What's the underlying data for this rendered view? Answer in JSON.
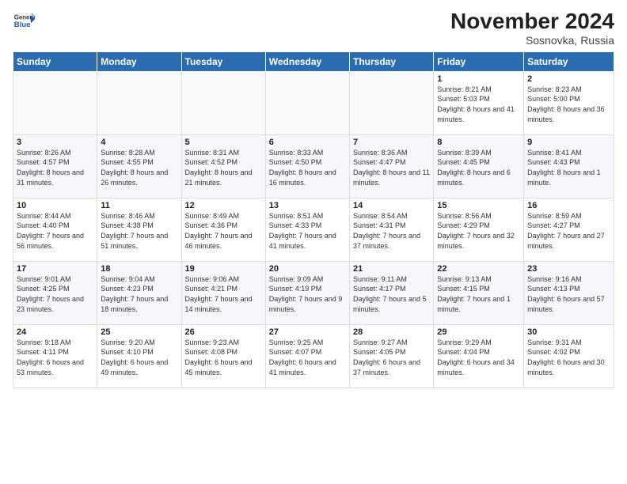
{
  "header": {
    "logo_line1": "General",
    "logo_line2": "Blue",
    "month_title": "November 2024",
    "location": "Sosnovka, Russia"
  },
  "weekdays": [
    "Sunday",
    "Monday",
    "Tuesday",
    "Wednesday",
    "Thursday",
    "Friday",
    "Saturday"
  ],
  "weeks": [
    [
      {
        "day": "",
        "info": ""
      },
      {
        "day": "",
        "info": ""
      },
      {
        "day": "",
        "info": ""
      },
      {
        "day": "",
        "info": ""
      },
      {
        "day": "",
        "info": ""
      },
      {
        "day": "1",
        "info": "Sunrise: 8:21 AM\nSunset: 5:03 PM\nDaylight: 8 hours and 41 minutes."
      },
      {
        "day": "2",
        "info": "Sunrise: 8:23 AM\nSunset: 5:00 PM\nDaylight: 8 hours and 36 minutes."
      }
    ],
    [
      {
        "day": "3",
        "info": "Sunrise: 8:26 AM\nSunset: 4:57 PM\nDaylight: 8 hours and 31 minutes."
      },
      {
        "day": "4",
        "info": "Sunrise: 8:28 AM\nSunset: 4:55 PM\nDaylight: 8 hours and 26 minutes."
      },
      {
        "day": "5",
        "info": "Sunrise: 8:31 AM\nSunset: 4:52 PM\nDaylight: 8 hours and 21 minutes."
      },
      {
        "day": "6",
        "info": "Sunrise: 8:33 AM\nSunset: 4:50 PM\nDaylight: 8 hours and 16 minutes."
      },
      {
        "day": "7",
        "info": "Sunrise: 8:36 AM\nSunset: 4:47 PM\nDaylight: 8 hours and 11 minutes."
      },
      {
        "day": "8",
        "info": "Sunrise: 8:39 AM\nSunset: 4:45 PM\nDaylight: 8 hours and 6 minutes."
      },
      {
        "day": "9",
        "info": "Sunrise: 8:41 AM\nSunset: 4:43 PM\nDaylight: 8 hours and 1 minute."
      }
    ],
    [
      {
        "day": "10",
        "info": "Sunrise: 8:44 AM\nSunset: 4:40 PM\nDaylight: 7 hours and 56 minutes."
      },
      {
        "day": "11",
        "info": "Sunrise: 8:46 AM\nSunset: 4:38 PM\nDaylight: 7 hours and 51 minutes."
      },
      {
        "day": "12",
        "info": "Sunrise: 8:49 AM\nSunset: 4:36 PM\nDaylight: 7 hours and 46 minutes."
      },
      {
        "day": "13",
        "info": "Sunrise: 8:51 AM\nSunset: 4:33 PM\nDaylight: 7 hours and 41 minutes."
      },
      {
        "day": "14",
        "info": "Sunrise: 8:54 AM\nSunset: 4:31 PM\nDaylight: 7 hours and 37 minutes."
      },
      {
        "day": "15",
        "info": "Sunrise: 8:56 AM\nSunset: 4:29 PM\nDaylight: 7 hours and 32 minutes."
      },
      {
        "day": "16",
        "info": "Sunrise: 8:59 AM\nSunset: 4:27 PM\nDaylight: 7 hours and 27 minutes."
      }
    ],
    [
      {
        "day": "17",
        "info": "Sunrise: 9:01 AM\nSunset: 4:25 PM\nDaylight: 7 hours and 23 minutes."
      },
      {
        "day": "18",
        "info": "Sunrise: 9:04 AM\nSunset: 4:23 PM\nDaylight: 7 hours and 18 minutes."
      },
      {
        "day": "19",
        "info": "Sunrise: 9:06 AM\nSunset: 4:21 PM\nDaylight: 7 hours and 14 minutes."
      },
      {
        "day": "20",
        "info": "Sunrise: 9:09 AM\nSunset: 4:19 PM\nDaylight: 7 hours and 9 minutes."
      },
      {
        "day": "21",
        "info": "Sunrise: 9:11 AM\nSunset: 4:17 PM\nDaylight: 7 hours and 5 minutes."
      },
      {
        "day": "22",
        "info": "Sunrise: 9:13 AM\nSunset: 4:15 PM\nDaylight: 7 hours and 1 minute."
      },
      {
        "day": "23",
        "info": "Sunrise: 9:16 AM\nSunset: 4:13 PM\nDaylight: 6 hours and 57 minutes."
      }
    ],
    [
      {
        "day": "24",
        "info": "Sunrise: 9:18 AM\nSunset: 4:11 PM\nDaylight: 6 hours and 53 minutes."
      },
      {
        "day": "25",
        "info": "Sunrise: 9:20 AM\nSunset: 4:10 PM\nDaylight: 6 hours and 49 minutes."
      },
      {
        "day": "26",
        "info": "Sunrise: 9:23 AM\nSunset: 4:08 PM\nDaylight: 6 hours and 45 minutes."
      },
      {
        "day": "27",
        "info": "Sunrise: 9:25 AM\nSunset: 4:07 PM\nDaylight: 6 hours and 41 minutes."
      },
      {
        "day": "28",
        "info": "Sunrise: 9:27 AM\nSunset: 4:05 PM\nDaylight: 6 hours and 37 minutes."
      },
      {
        "day": "29",
        "info": "Sunrise: 9:29 AM\nSunset: 4:04 PM\nDaylight: 6 hours and 34 minutes."
      },
      {
        "day": "30",
        "info": "Sunrise: 9:31 AM\nSunset: 4:02 PM\nDaylight: 6 hours and 30 minutes."
      }
    ]
  ]
}
